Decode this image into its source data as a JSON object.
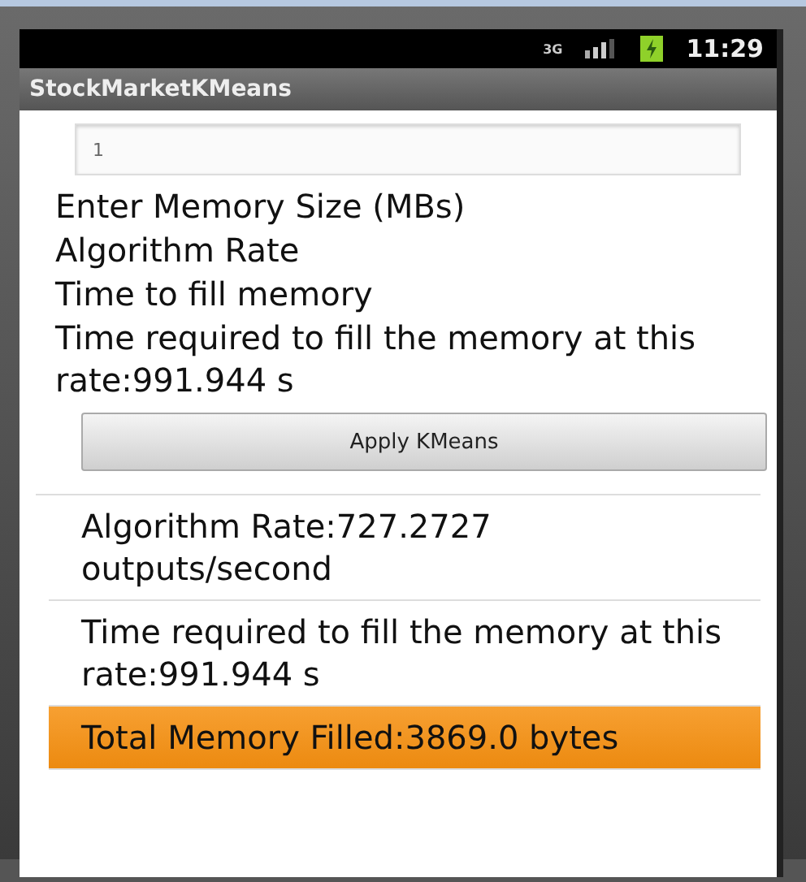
{
  "status_bar": {
    "network": "3G",
    "time": "11:29"
  },
  "title_bar": {
    "title": "StockMarketKMeans"
  },
  "form": {
    "input": {
      "value": "1"
    },
    "labels": [
      "Enter Memory Size (MBs)",
      "Algorithm Rate",
      "Time to fill memory",
      "Time required to fill the memory at this rate:991.944 s"
    ],
    "button": "Apply KMeans"
  },
  "results": [
    {
      "text": "Algorithm Rate:727.2727 outputs/second",
      "selected": false
    },
    {
      "text": "Time required to fill the memory at this rate:991.944 s",
      "selected": false
    },
    {
      "text": "Total Memory Filled:3869.0 bytes",
      "selected": true
    }
  ]
}
